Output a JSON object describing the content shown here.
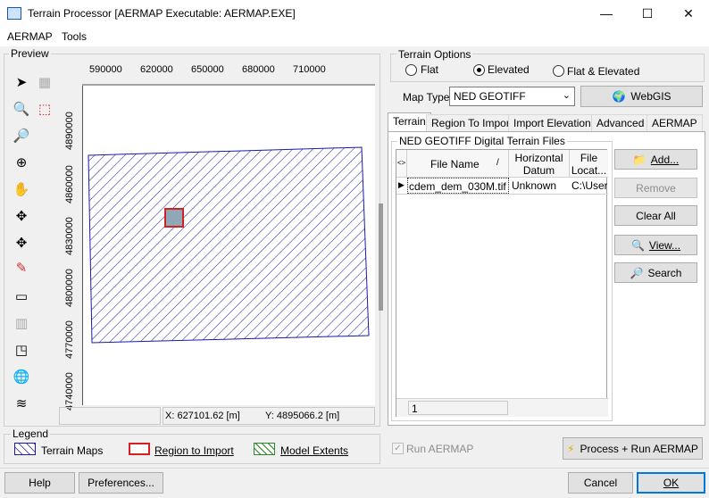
{
  "window": {
    "title": "Terrain Processor [AERMAP Executable: AERMAP.EXE]",
    "minimize": "—",
    "maximize": "☐",
    "close": "✕"
  },
  "menu": {
    "items": [
      "AERMAP",
      "Tools"
    ]
  },
  "preview": {
    "title": "Preview",
    "x_ticks": [
      "590000",
      "620000",
      "650000",
      "680000",
      "710000"
    ],
    "y_ticks": [
      "4890000",
      "4860000",
      "4830000",
      "4800000",
      "4770000",
      "4740000"
    ],
    "status_x": "X: 627101.62 [m]",
    "status_y": "Y: 4895066.2 [m]"
  },
  "legend": {
    "title": "Legend",
    "terrain_maps": "Terrain Maps",
    "region_to_import": "Region to Import",
    "model_extents": "Model Extents"
  },
  "terrain_options": {
    "title": "Terrain Options",
    "flat": "Flat",
    "elevated": "Elevated",
    "flat_elevated": "Flat & Elevated",
    "selected": "Elevated"
  },
  "map_type": {
    "label": "Map Type:",
    "value": "NED GEOTIFF",
    "webgis": "WebGIS"
  },
  "tabs": [
    "Terrain",
    "Region To Import",
    "Import Elevations",
    "Advanced",
    "AERMAP"
  ],
  "files": {
    "title": "NED GEOTIFF Digital Terrain Files",
    "headers": {
      "file_name": "File Name",
      "sort_mark": "/",
      "horizontal_datum": "Horizontal Datum",
      "file_location": "File Locat..."
    },
    "rows": [
      {
        "file_name": "cdem_dem_030M.tif",
        "datum": "Unknown",
        "location": "C:\\Users"
      }
    ],
    "count": "1",
    "add": "Add...",
    "remove": "Remove",
    "clear_all": "Clear All",
    "view": "View...",
    "search": "Search"
  },
  "run_aermap": "Run AERMAP",
  "process_run": "Process + Run AERMAP",
  "footer": {
    "help": "Help",
    "preferences": "Preferences...",
    "cancel": "Cancel",
    "ok": "OK"
  },
  "colors": {
    "accent": "#0078d7",
    "hatch_blue": "#1a1aa8",
    "region_red": "#d42020",
    "model_green": "#2a8a2a"
  }
}
